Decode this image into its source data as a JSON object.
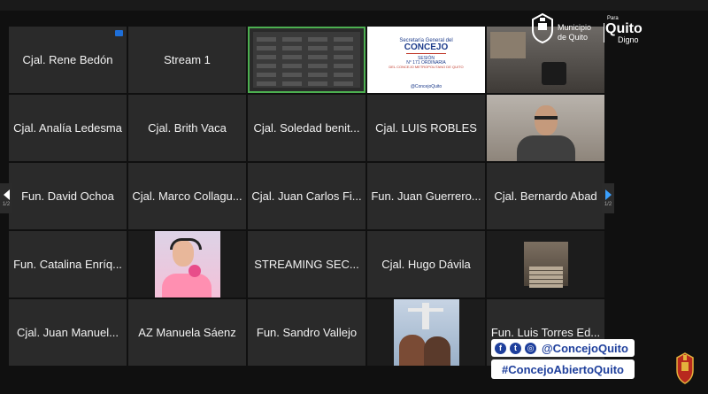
{
  "participants": [
    {
      "name": "Cjal. Rene Bedón",
      "kind": "name",
      "badge": true
    },
    {
      "name": "Stream 1",
      "kind": "name"
    },
    {
      "name": "",
      "kind": "share"
    },
    {
      "name": "",
      "kind": "slide"
    },
    {
      "name": "",
      "kind": "video-room"
    },
    {
      "name": "Cjal. Analía Ledesma",
      "kind": "name"
    },
    {
      "name": "Cjal. Brith Vaca",
      "kind": "name"
    },
    {
      "name": "Cjal. Soledad benit...",
      "kind": "name"
    },
    {
      "name": "Cjal. LUIS ROBLES",
      "kind": "name"
    },
    {
      "name": "",
      "kind": "video-man"
    },
    {
      "name": "Fun. David Ochoa",
      "kind": "name"
    },
    {
      "name": "Cjal. Marco Collagu...",
      "kind": "name"
    },
    {
      "name": "Cjal. Juan Carlos Fi...",
      "kind": "name"
    },
    {
      "name": "Fun. Juan Guerrero...",
      "kind": "name"
    },
    {
      "name": "Cjal. Bernardo Abad",
      "kind": "name"
    },
    {
      "name": "Fun. Catalina Enríq...",
      "kind": "name"
    },
    {
      "name": "",
      "kind": "video-woman"
    },
    {
      "name": "STREAMING SEC...",
      "kind": "name"
    },
    {
      "name": "Cjal. Hugo Dávila",
      "kind": "name"
    },
    {
      "name": "",
      "kind": "video-stairs"
    },
    {
      "name": "Cjal. Juan Manuel...",
      "kind": "name"
    },
    {
      "name": "AZ Manuela Sáenz",
      "kind": "name"
    },
    {
      "name": "Fun. Sandro Vallejo",
      "kind": "name"
    },
    {
      "name": "",
      "kind": "video-christ"
    },
    {
      "name": "Fun. Luis Torres Ed...",
      "kind": "name"
    }
  ],
  "slide": {
    "line1": "Secretaría General del",
    "line2": "CONCEJO",
    "line3": "SESIÓN",
    "line4": "N° 171 ORDINARIA",
    "line5": "DEL CONCEJO METROPOLITANO DE QUITO",
    "social": "@ConcejoQuito"
  },
  "logo": {
    "muni_line1": "Municipio",
    "muni_line2": "de Quito",
    "q_small": "Para",
    "q_big": "Quito",
    "q_digno": "Digno"
  },
  "banner": {
    "handle": "@ConcejoQuito",
    "hashtag": "#ConcejoAbiertoQuito"
  },
  "pager": {
    "left_num": "1/2",
    "right_num": "1/2"
  },
  "colors": {
    "brand_blue": "#1e3f9c",
    "active_outline": "#4caf50",
    "tile_bg": "#2a2a2a"
  }
}
